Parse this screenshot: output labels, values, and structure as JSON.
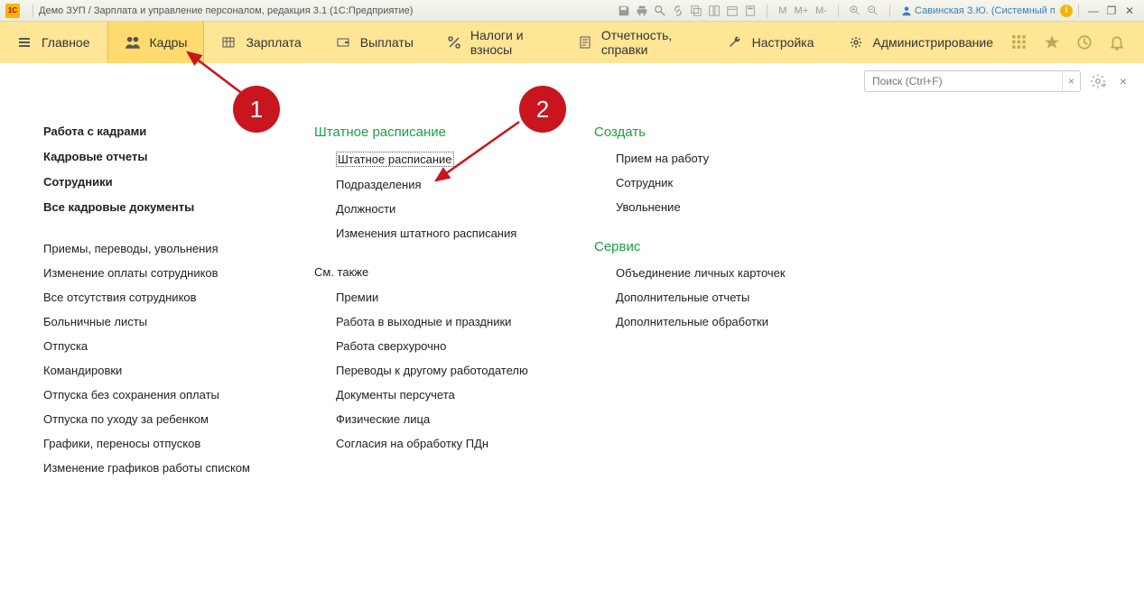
{
  "titlebar": {
    "title": "Демо ЗУП / Зарплата и управление персоналом, редакция 3.1  (1С:Предприятие)",
    "m_labels": [
      "М",
      "М+",
      "М-"
    ],
    "user": "Савинская З.Ю. (Системный прог..."
  },
  "nav": {
    "items": [
      {
        "label": "Главное"
      },
      {
        "label": "Кадры"
      },
      {
        "label": "Зарплата"
      },
      {
        "label": "Выплаты"
      },
      {
        "label": "Налоги и взносы"
      },
      {
        "label": "Отчетность, справки"
      },
      {
        "label": "Настройка"
      },
      {
        "label": "Администрирование"
      }
    ]
  },
  "search": {
    "placeholder": "Поиск (Ctrl+F)"
  },
  "col1": {
    "bold": [
      "Работа с кадрами",
      "Кадровые отчеты",
      "Сотрудники",
      "Все кадровые документы"
    ],
    "plain": [
      "Приемы, переводы, увольнения",
      "Изменение оплаты сотрудников",
      "Все отсутствия сотрудников",
      "Больничные листы",
      "Отпуска",
      "Командировки",
      "Отпуска без сохранения оплаты",
      "Отпуска по уходу за ребенком",
      "Графики, переносы отпусков",
      "Изменение графиков работы списком"
    ]
  },
  "col2": {
    "title1": "Штатное расписание",
    "group1": [
      "Штатное расписание",
      "Подразделения",
      "Должности",
      "Изменения штатного расписания"
    ],
    "title2": "См. также",
    "group2": [
      "Премии",
      "Работа в выходные и праздники",
      "Работа сверхурочно",
      "Переводы к другому работодателю",
      "Документы персучета",
      "Физические лица",
      "Согласия на обработку ПДн"
    ]
  },
  "col3": {
    "title1": "Создать",
    "group1": [
      "Прием на работу",
      "Сотрудник",
      "Увольнение"
    ],
    "title2": "Сервис",
    "group2": [
      "Объединение личных карточек",
      "Дополнительные отчеты",
      "Дополнительные обработки"
    ]
  },
  "annotations": {
    "bubble1": "1",
    "bubble2": "2"
  }
}
